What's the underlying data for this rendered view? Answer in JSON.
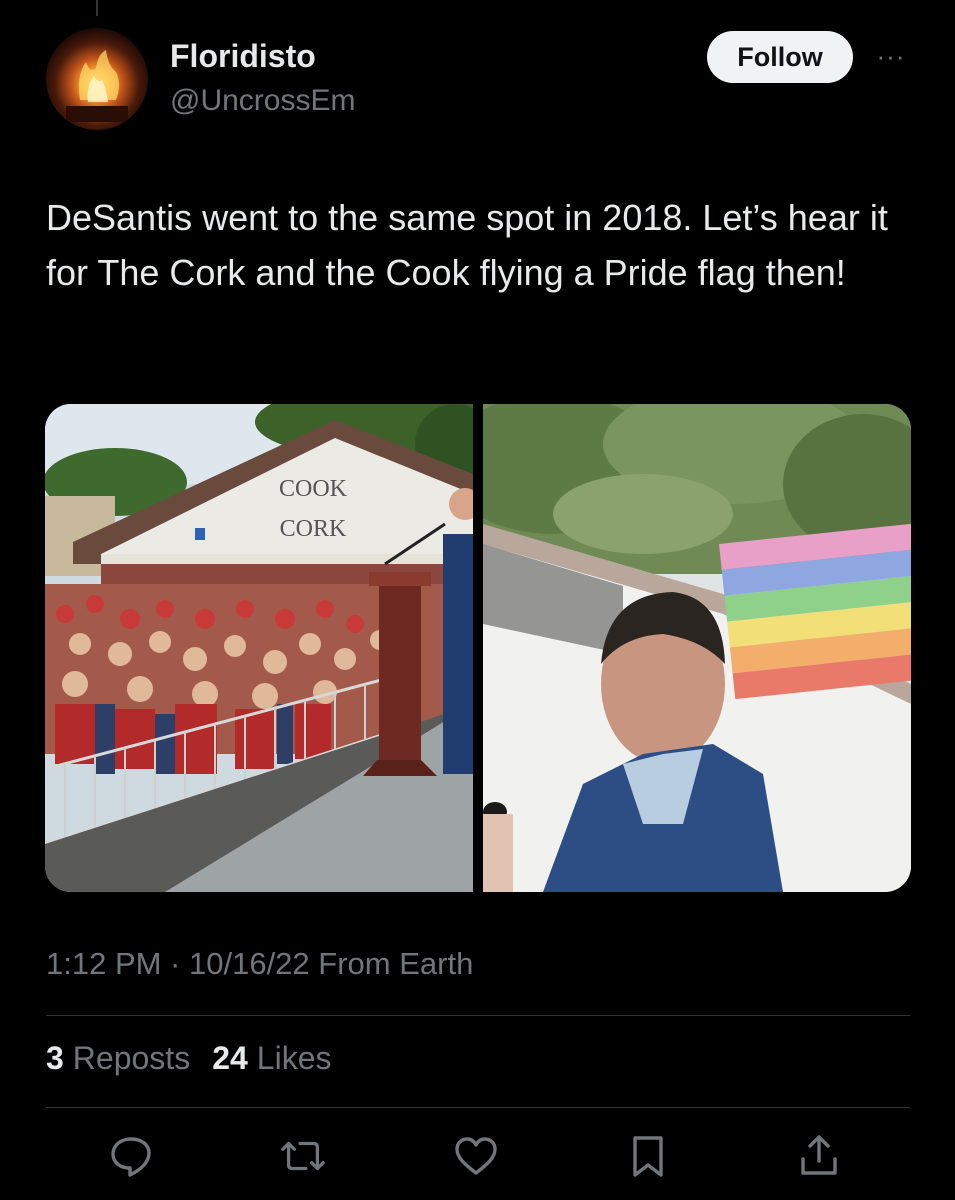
{
  "author": {
    "display_name": "Floridisto",
    "handle": "@UncrossEm",
    "avatar_icon": "fire-avatar"
  },
  "follow_label": "Follow",
  "more_label": "···",
  "tweet": {
    "text": "DeSantis went to the same spot in 2018. Let’s hear it for The Cork and the Cook flying a Pride flag then!",
    "timestamp": "1:12 PM · 10/16/22 From Earth"
  },
  "media": {
    "left_photo": {
      "sign_line1": "COOK",
      "sign_line2": "CORK"
    }
  },
  "stats": {
    "reposts_count": "3",
    "reposts_label": "Reposts",
    "likes_count": "24",
    "likes_label": "Likes"
  },
  "actions": [
    "reply-icon",
    "repost-icon",
    "like-icon",
    "bookmark-icon",
    "share-icon"
  ],
  "colors": {
    "background": "#000000",
    "text": "#e7e9ea",
    "muted": "#71767b",
    "divider": "#2f3336",
    "follow_bg": "#eff3f4"
  }
}
